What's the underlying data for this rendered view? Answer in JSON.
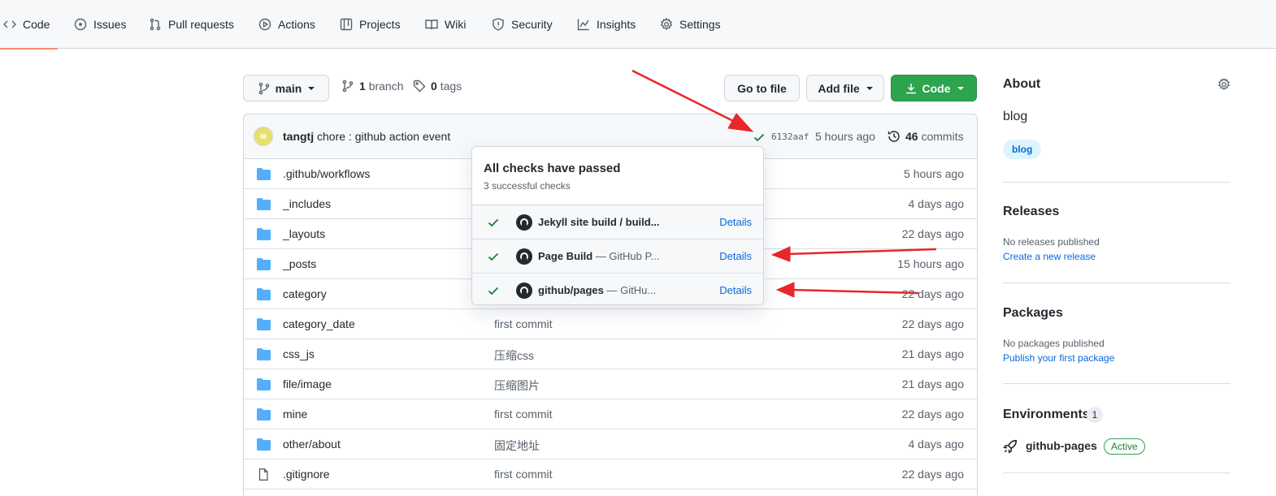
{
  "nav": {
    "tabs": [
      {
        "label": "Code",
        "icon": "code-icon",
        "active": true
      },
      {
        "label": "Issues",
        "icon": "issue-icon"
      },
      {
        "label": "Pull requests",
        "icon": "pull-request-icon"
      },
      {
        "label": "Actions",
        "icon": "play-icon"
      },
      {
        "label": "Projects",
        "icon": "table-icon"
      },
      {
        "label": "Wiki",
        "icon": "book-icon"
      },
      {
        "label": "Security",
        "icon": "shield-icon"
      },
      {
        "label": "Insights",
        "icon": "graph-icon"
      },
      {
        "label": "Settings",
        "icon": "gear-icon"
      }
    ]
  },
  "repo_bar": {
    "branch": "main",
    "branch_count": "1",
    "branch_label": "branch",
    "tag_count": "0",
    "tag_label": "tags",
    "go_to_file": "Go to file",
    "add_file": "Add file",
    "code_button": "Code"
  },
  "latest_commit": {
    "author": "tangtj",
    "message": "chore : github action event",
    "sha": "6132aaf",
    "time": "5 hours ago",
    "commit_count": "46",
    "commit_label": "commits"
  },
  "files": [
    {
      "name": ".github/workflows",
      "type": "dir",
      "message": "",
      "age": "5 hours ago"
    },
    {
      "name": "_includes",
      "type": "dir",
      "message": "",
      "age": "4 days ago"
    },
    {
      "name": "_layouts",
      "type": "dir",
      "message": "",
      "age": "22 days ago"
    },
    {
      "name": "_posts",
      "type": "dir",
      "message": "",
      "age": "15 hours ago"
    },
    {
      "name": "category",
      "type": "dir",
      "message": "",
      "age": "22 days ago"
    },
    {
      "name": "category_date",
      "type": "dir",
      "message": "first commit",
      "age": "22 days ago"
    },
    {
      "name": "css_js",
      "type": "dir",
      "message": "压缩css",
      "age": "21 days ago"
    },
    {
      "name": "file/image",
      "type": "dir",
      "message": "压缩图片",
      "age": "21 days ago"
    },
    {
      "name": "mine",
      "type": "dir",
      "message": "first commit",
      "age": "22 days ago"
    },
    {
      "name": "other/about",
      "type": "dir",
      "message": "固定地址",
      "age": "4 days ago"
    },
    {
      "name": ".gitignore",
      "type": "file",
      "message": "first commit",
      "age": "22 days ago"
    }
  ],
  "checks_popover": {
    "title": "All checks have passed",
    "subtitle": "3 successful checks",
    "checks": [
      {
        "name": "Jekyll site build / build...",
        "desc": "",
        "details": "Details"
      },
      {
        "name": "Page Build",
        "desc": " — GitHub P...",
        "details": "Details"
      },
      {
        "name": "github/pages",
        "desc": " — GitHu...",
        "details": "Details"
      }
    ]
  },
  "sidebar": {
    "about_title": "About",
    "description": "blog",
    "topic": "blog",
    "releases_title": "Releases",
    "releases_text": "No releases published",
    "releases_link": "Create a new release",
    "packages_title": "Packages",
    "packages_text": "No packages published",
    "packages_link": "Publish your first package",
    "environments_title": "Environments",
    "environments_count": "1",
    "environment_name": "github-pages",
    "environment_status": "Active"
  },
  "colors": {
    "accent_green": "#2da44e",
    "link_blue": "#0969da",
    "folder_blue": "#54aeff",
    "annotation_red": "#e8262b"
  }
}
